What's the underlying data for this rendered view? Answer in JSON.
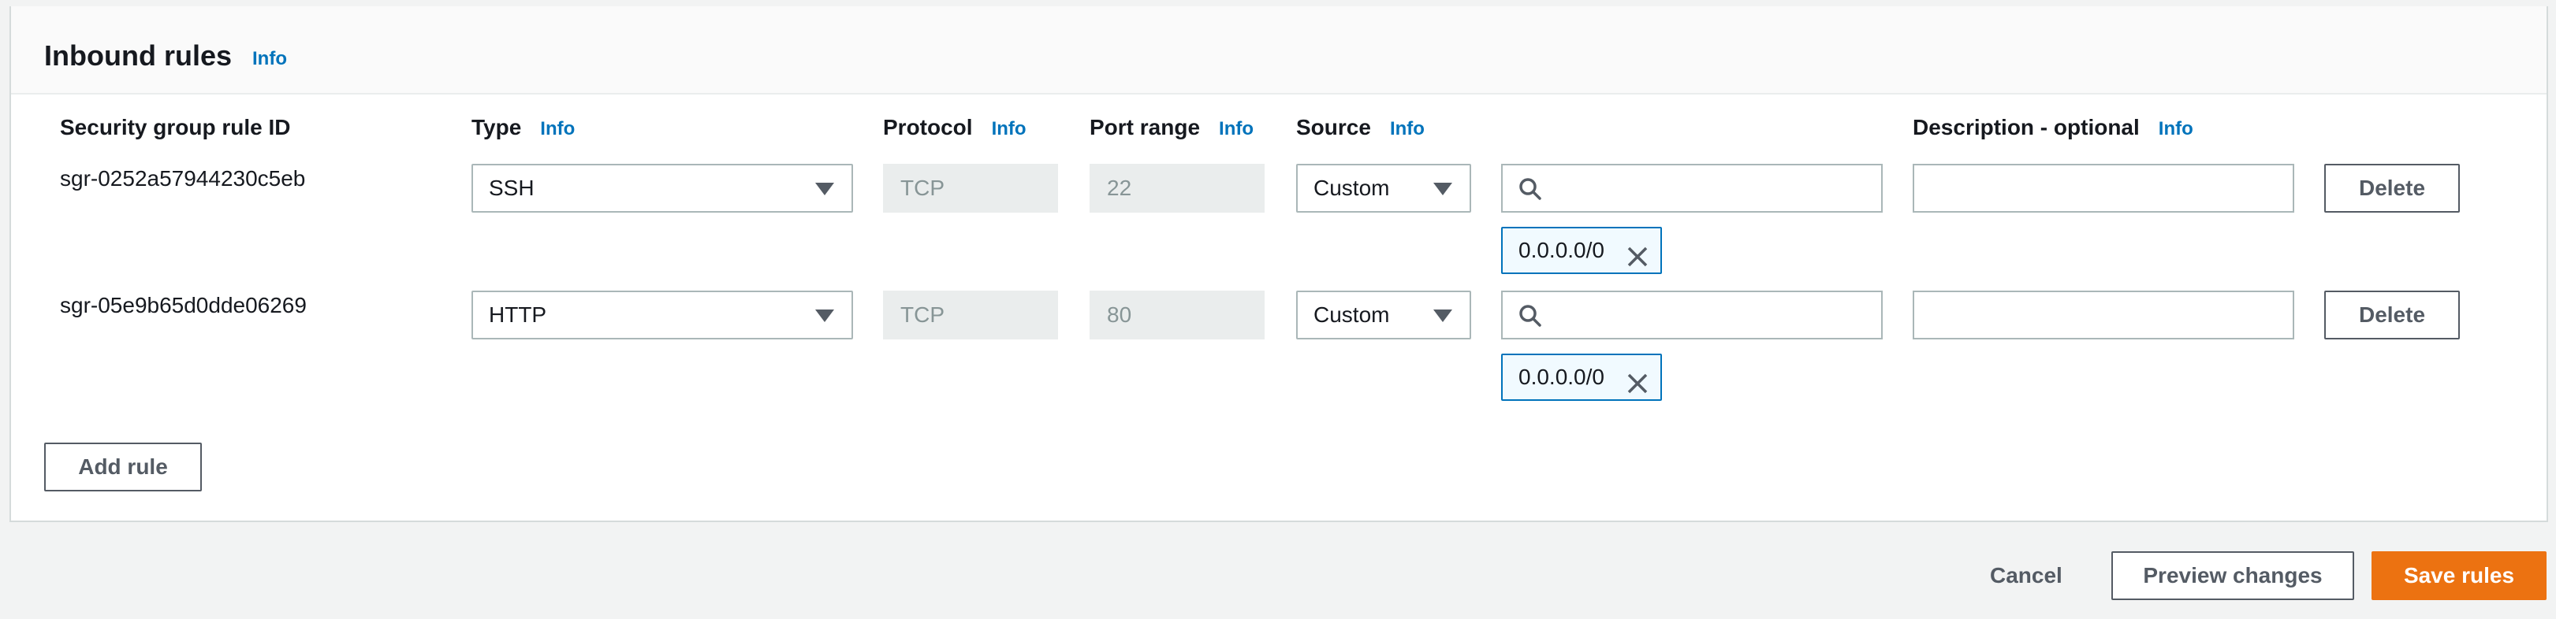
{
  "panel": {
    "title": "Inbound rules",
    "info": "Info"
  },
  "columns": {
    "rule_id": "Security group rule ID",
    "type": "Type",
    "protocol": "Protocol",
    "port_range": "Port range",
    "source": "Source",
    "description": "Description - optional",
    "info": "Info"
  },
  "rules": [
    {
      "id": "sgr-0252a57944230c5eb",
      "type": "SSH",
      "protocol": "TCP",
      "port": "22",
      "source": "Custom",
      "search_value": "",
      "cidr": "0.0.0.0/0",
      "description": "",
      "delete_label": "Delete"
    },
    {
      "id": "sgr-05e9b65d0dde06269",
      "type": "HTTP",
      "protocol": "TCP",
      "port": "80",
      "source": "Custom",
      "search_value": "",
      "cidr": "0.0.0.0/0",
      "description": "",
      "delete_label": "Delete"
    }
  ],
  "add_rule_label": "Add rule",
  "footer": {
    "cancel": "Cancel",
    "preview": "Preview changes",
    "save": "Save rules"
  },
  "colors": {
    "accent": "#ec7211",
    "link": "#0073bb",
    "border": "#aab7b8"
  }
}
